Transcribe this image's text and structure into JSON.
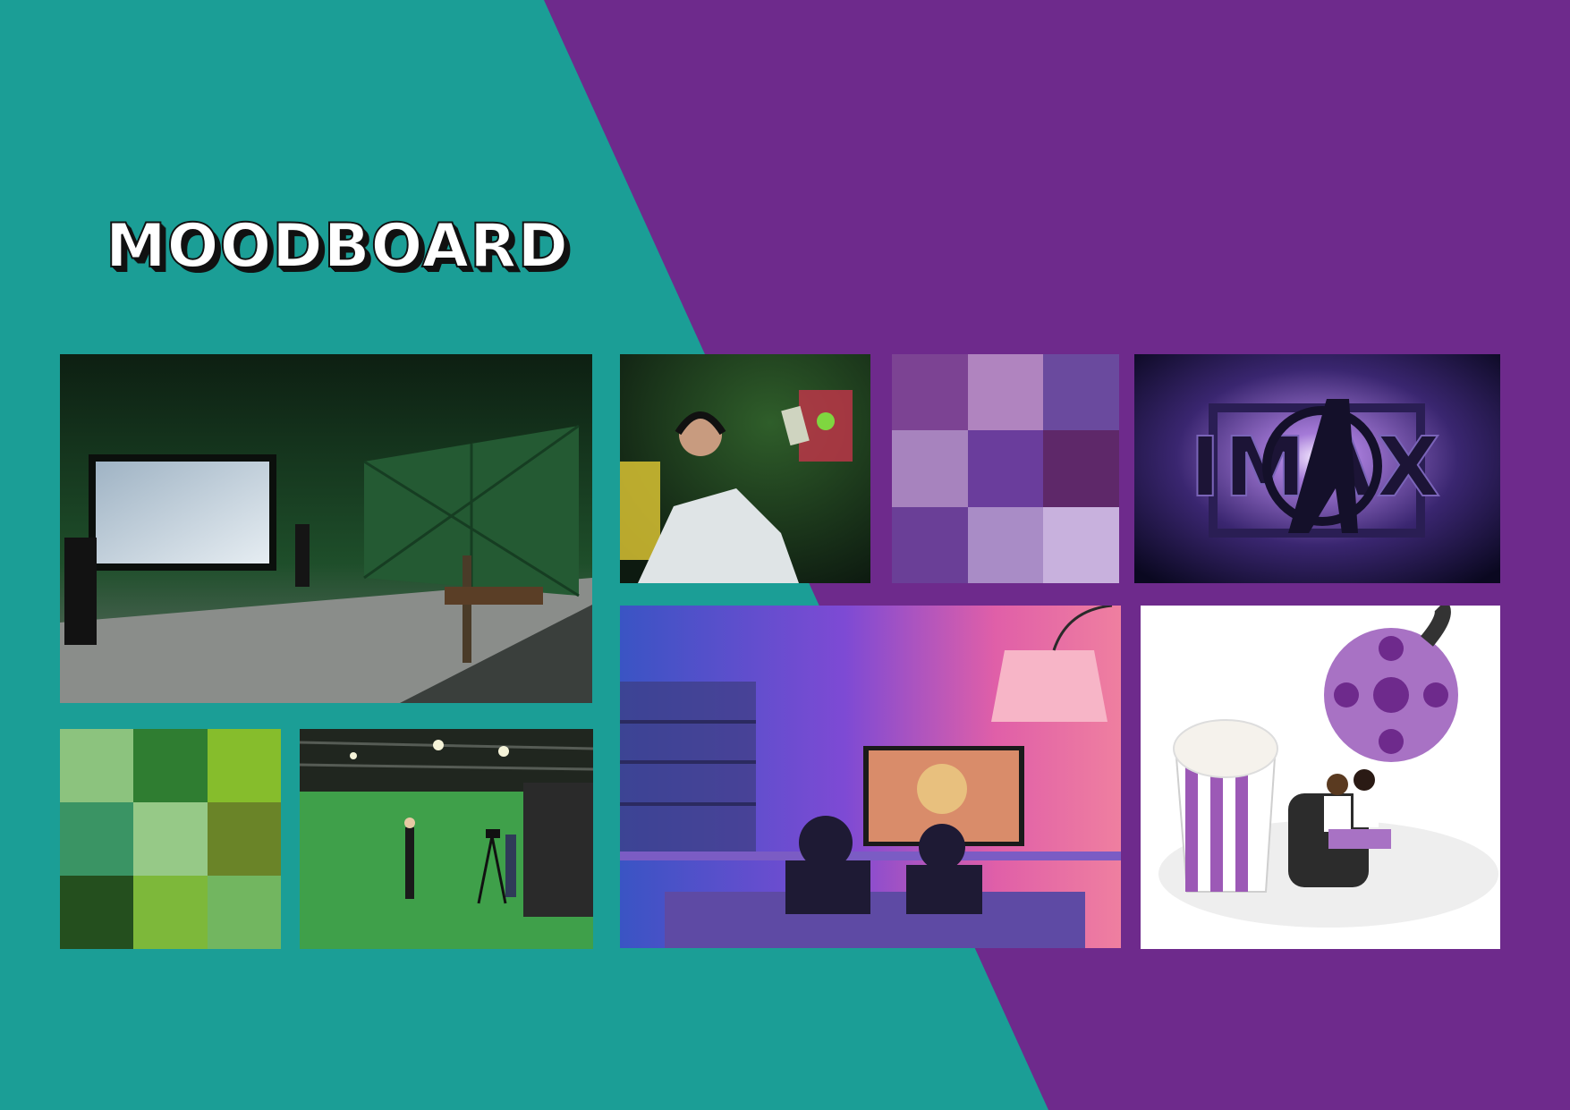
{
  "title": "MOODBOARD",
  "colors": {
    "teal": "#1b9e96",
    "purple": "#6e2a8c"
  },
  "green_palette": [
    "#8cc37e",
    "#2f7d31",
    "#86bd2c",
    "#3a9464",
    "#96c987",
    "#6a8428",
    "#244f1e",
    "#7db83a",
    "#72b660"
  ],
  "purple_palette": [
    "#7c4393",
    "#b084bf",
    "#6a4a9e",
    "#a783be",
    "#6a3d9c",
    "#5e2869",
    "#6a3f97",
    "#a98cc6",
    "#c8b1dd"
  ],
  "imax": {
    "text": "IMAX"
  }
}
